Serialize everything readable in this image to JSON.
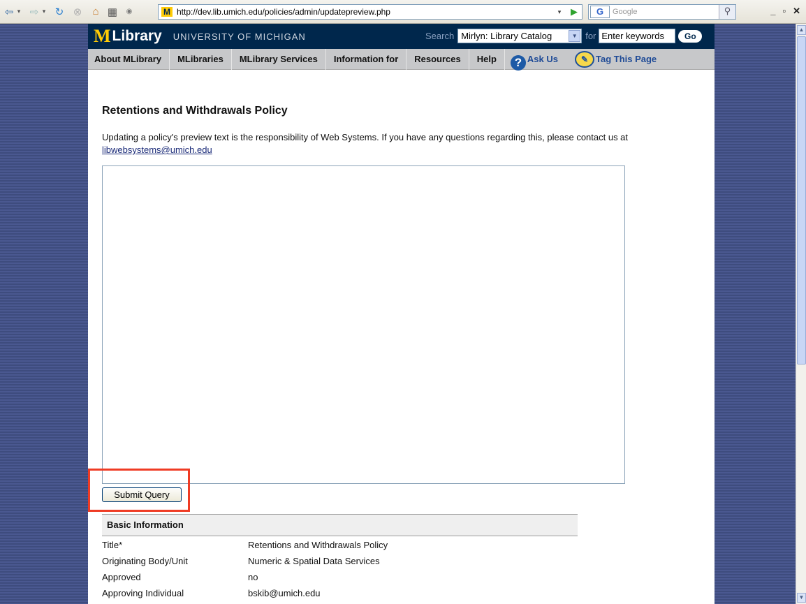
{
  "browser": {
    "url": "http://dev.lib.umich.edu/policies/admin/updatepreview.php",
    "google_placeholder": "Google"
  },
  "site": {
    "logo_m": "M",
    "logo_library": "Library",
    "logo_university": "UNIVERSITY OF MICHIGAN",
    "search_label": "Search",
    "search_scope": "Mirlyn: Library Catalog",
    "for_label": "for",
    "keywords_value": "Enter keywords",
    "go_label": "Go"
  },
  "nav": {
    "items": [
      "About MLibrary",
      "MLibraries",
      "MLibrary Services",
      "Information for",
      "Resources",
      "Help"
    ],
    "ask_us": "Ask Us",
    "tag_page": "Tag This Page"
  },
  "main": {
    "title": "Retentions and Withdrawals Policy",
    "intro_text": "Updating a policy's preview text is the responsibility of Web Systems. If you have any questions regarding this, please contact us at",
    "contact_email": "libwebsystems@umich.edu",
    "preview_text": "",
    "submit_label": "Submit Query"
  },
  "basic_info": {
    "heading": "Basic Information",
    "rows": [
      {
        "label": "Title*",
        "value": "Retentions and Withdrawals Policy"
      },
      {
        "label": "Originating Body/Unit",
        "value": "Numeric & Spatial Data Services"
      },
      {
        "label": "Approved",
        "value": "no"
      },
      {
        "label": "Approving Individual",
        "value": "bskib@umich.edu"
      }
    ]
  },
  "colors": {
    "brand_blue": "#00274c",
    "brand_maize": "#ffcb05",
    "highlight": "#ef3b24"
  }
}
